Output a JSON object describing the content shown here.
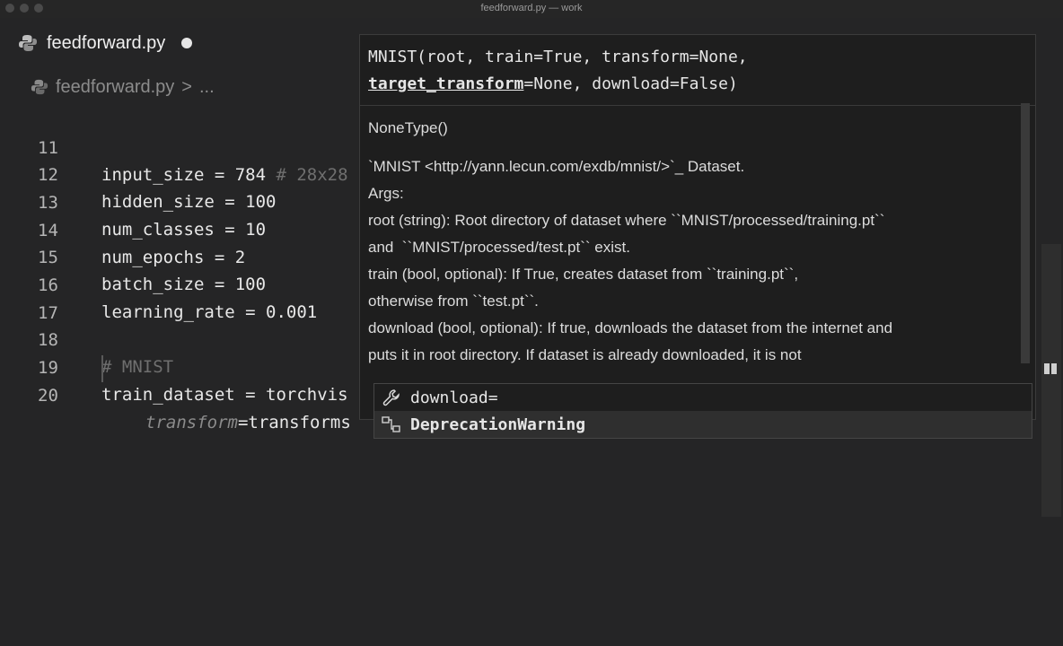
{
  "window": {
    "title": "feedforward.py — work"
  },
  "tab": {
    "label": "feedforward.py"
  },
  "breadcrumb": {
    "file": "feedforward.py",
    "separator": ">",
    "more": "..."
  },
  "editor": {
    "lines": [
      {
        "number": "11",
        "code": "input_size = 784 ",
        "comment": "# 28x28"
      },
      {
        "number": "12",
        "code": "hidden_size = 100"
      },
      {
        "number": "13",
        "code": "num_classes = 10"
      },
      {
        "number": "14",
        "code": "num_epochs = 2"
      },
      {
        "number": "15",
        "code": "batch_size = 100"
      },
      {
        "number": "16",
        "code": "learning_rate = 0.001"
      },
      {
        "number": "17",
        "code": ""
      },
      {
        "number": "18",
        "comment": "# MNIST"
      },
      {
        "number": "19",
        "code": "train_dataset = torchvis"
      },
      {
        "number": "20",
        "kwarg": "transform",
        "code": "=transforms"
      }
    ]
  },
  "hover": {
    "signature_line1": "MNIST(root, train=True, transform=None,",
    "signature_param": "target_transform",
    "signature_rest": "=None, download=False)",
    "type": "NoneType()",
    "doc_lines": [
      "`MNIST <http://yann.lecun.com/exdb/mnist/>`_ Dataset.",
      "Args:",
      "root (string): Root directory of dataset where ``MNIST/processed/training.pt``",
      "and  ``MNIST/processed/test.pt`` exist.",
      "train (bool, optional): If True, creates dataset from ``training.pt``,",
      "otherwise from ``test.pt``.",
      "download (bool, optional): If true, downloads the dataset from the internet and",
      "puts it in root directory. If dataset is already downloaded, it is not"
    ]
  },
  "suggest": {
    "items": [
      {
        "label": "download=",
        "icon": "wrench-icon"
      },
      {
        "label": "DeprecationWarning",
        "icon": "class-icon"
      }
    ]
  }
}
